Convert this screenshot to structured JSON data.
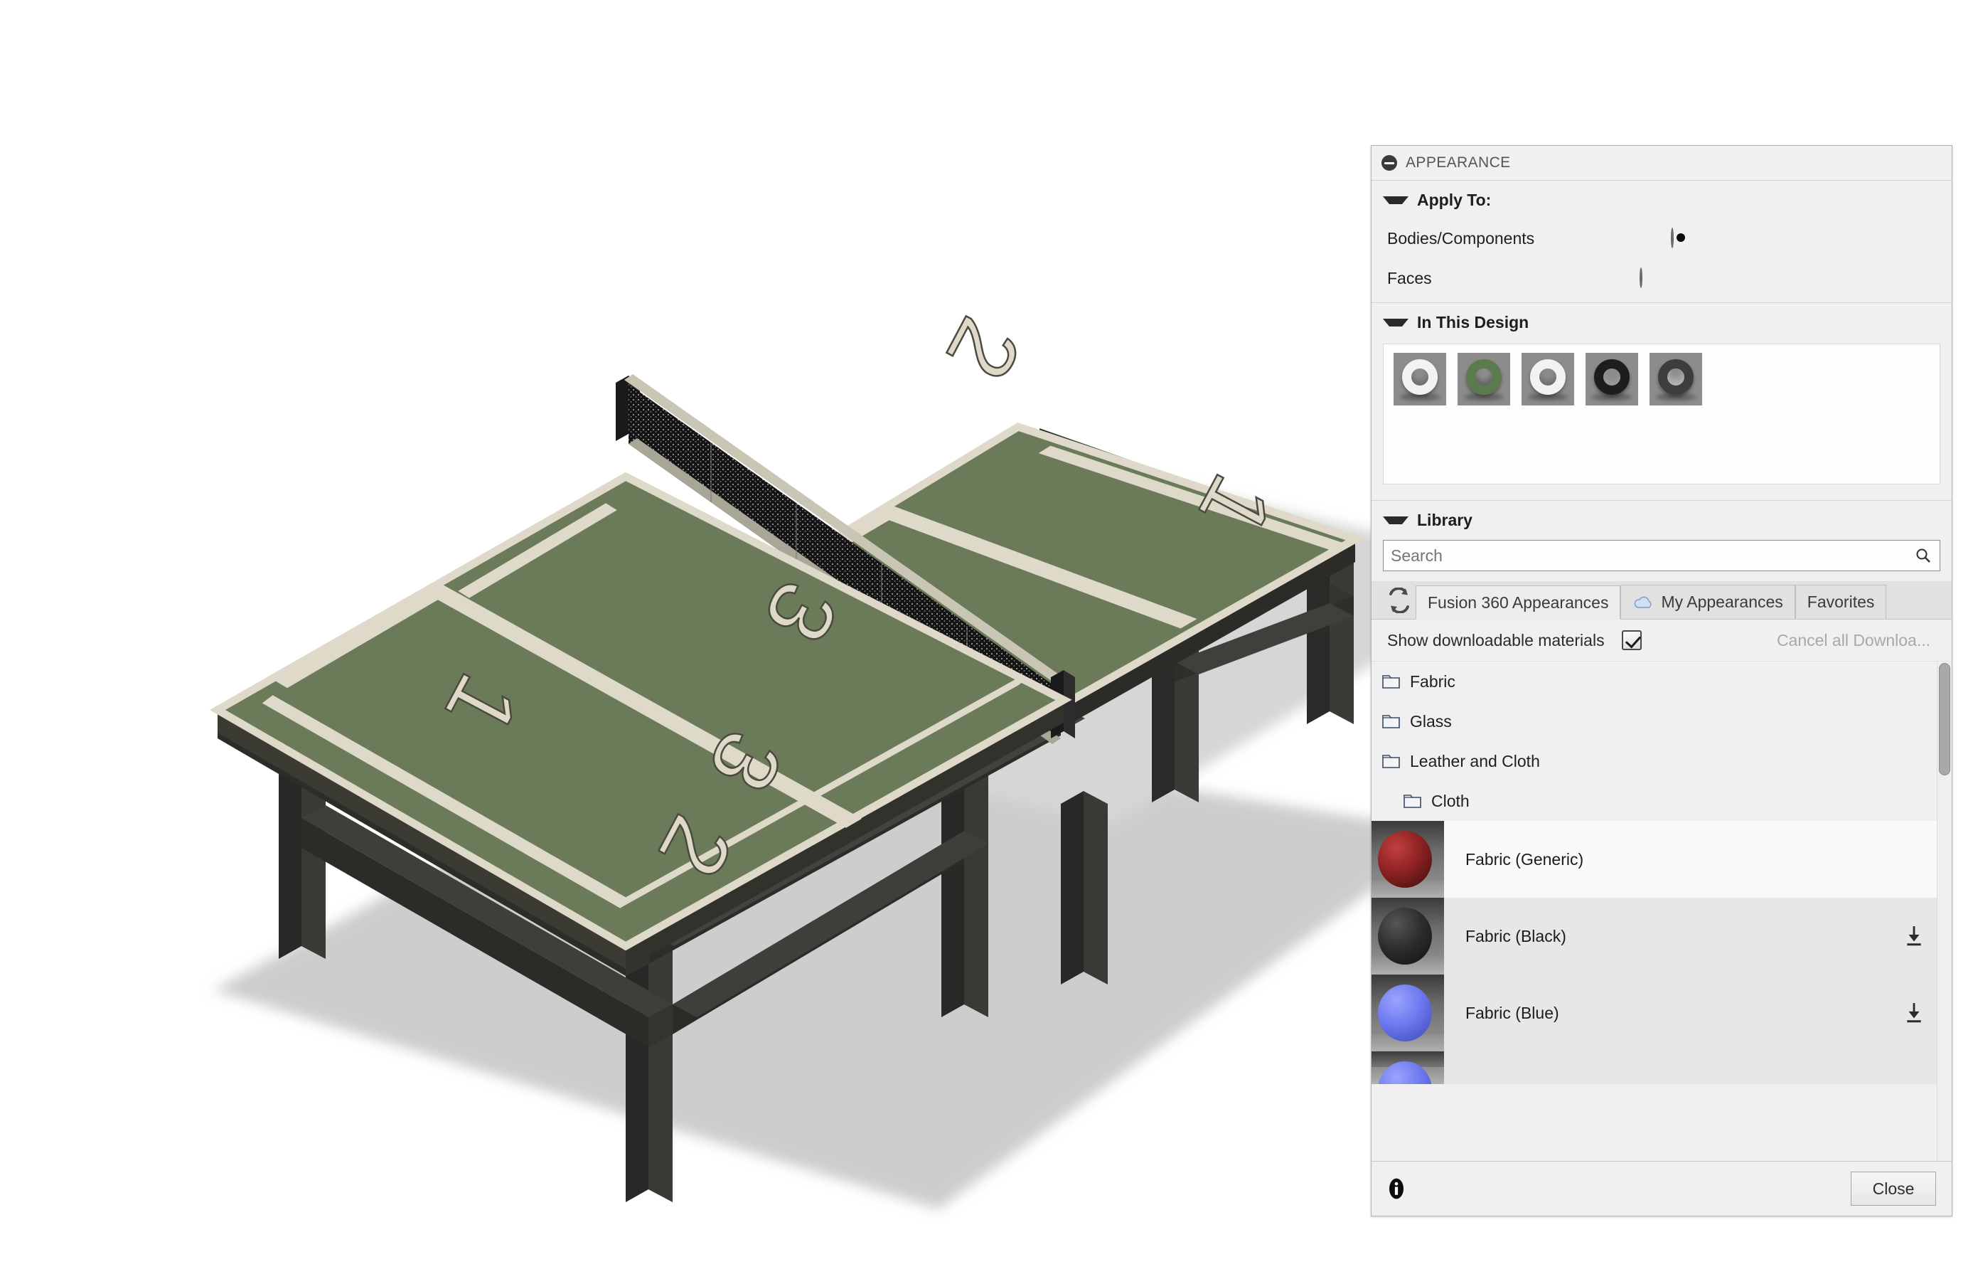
{
  "viewport": {
    "label": "3d-model-canvas",
    "model_name": "ping-pong-table",
    "background_color": "#ffffff",
    "colors": {
      "table_top": "#6b7b5a",
      "table_top_shade": "#5d6d4d",
      "line_marking": "#ded9c8",
      "frame_dark": "#2f2f2d",
      "frame_dark_light": "#3b3b38",
      "net_black": "#181818",
      "floor_shadow": "#cdcdcd"
    },
    "court_numbers": [
      "2",
      "1",
      "3",
      "3",
      "1",
      "2"
    ]
  },
  "dialog": {
    "title": "APPEARANCE",
    "collapse_icon": "collapse-icon",
    "apply_to": {
      "heading": "Apply To:",
      "options": [
        {
          "label": "Bodies/Components",
          "selected": true
        },
        {
          "label": "Faces",
          "selected": false
        }
      ]
    },
    "in_this_design": {
      "heading": "In This Design",
      "swatches": [
        {
          "name": "appearance-swatch-white-1",
          "style": "white"
        },
        {
          "name": "appearance-swatch-green",
          "style": "green"
        },
        {
          "name": "appearance-swatch-white-2",
          "style": "white"
        },
        {
          "name": "appearance-swatch-black",
          "style": "black"
        },
        {
          "name": "appearance-swatch-metal",
          "style": "metal"
        }
      ]
    },
    "library": {
      "heading": "Library",
      "search": {
        "placeholder": "Search",
        "value": ""
      },
      "refresh_icon": "refresh-icon",
      "tabs": [
        {
          "label": "Fusion 360 Appearances",
          "active": true,
          "icon": null
        },
        {
          "label": "My Appearances",
          "active": false,
          "icon": "cloud-icon"
        },
        {
          "label": "Favorites",
          "active": false,
          "icon": null
        }
      ],
      "show_downloadable": {
        "label": "Show downloadable materials",
        "checked": true
      },
      "cancel_downloads_label": "Cancel all Downloa...",
      "tree": [
        {
          "type": "folder",
          "label": "Fabric",
          "indent": 0
        },
        {
          "type": "folder",
          "label": "Glass",
          "indent": 0
        },
        {
          "type": "folder",
          "label": "Leather and Cloth",
          "indent": 0
        },
        {
          "type": "folder",
          "label": "Cloth",
          "indent": 1
        }
      ],
      "materials": [
        {
          "label": "Fabric (Generic)",
          "color": "#8e2222",
          "downloadable": false,
          "row_style": "sel"
        },
        {
          "label": "Fabric (Black)",
          "color": "#2c2c2c",
          "downloadable": true,
          "row_style": "alt"
        },
        {
          "label": "Fabric (Blue)",
          "color": "#6b77ee",
          "downloadable": true,
          "row_style": "alt"
        },
        {
          "label": "",
          "color": "#6b77ee",
          "downloadable": true,
          "row_style": "alt"
        }
      ],
      "scrollbar": {
        "name": "material-list-scrollbar"
      }
    },
    "footer": {
      "info_icon": "info-icon",
      "close_label": "Close"
    }
  }
}
